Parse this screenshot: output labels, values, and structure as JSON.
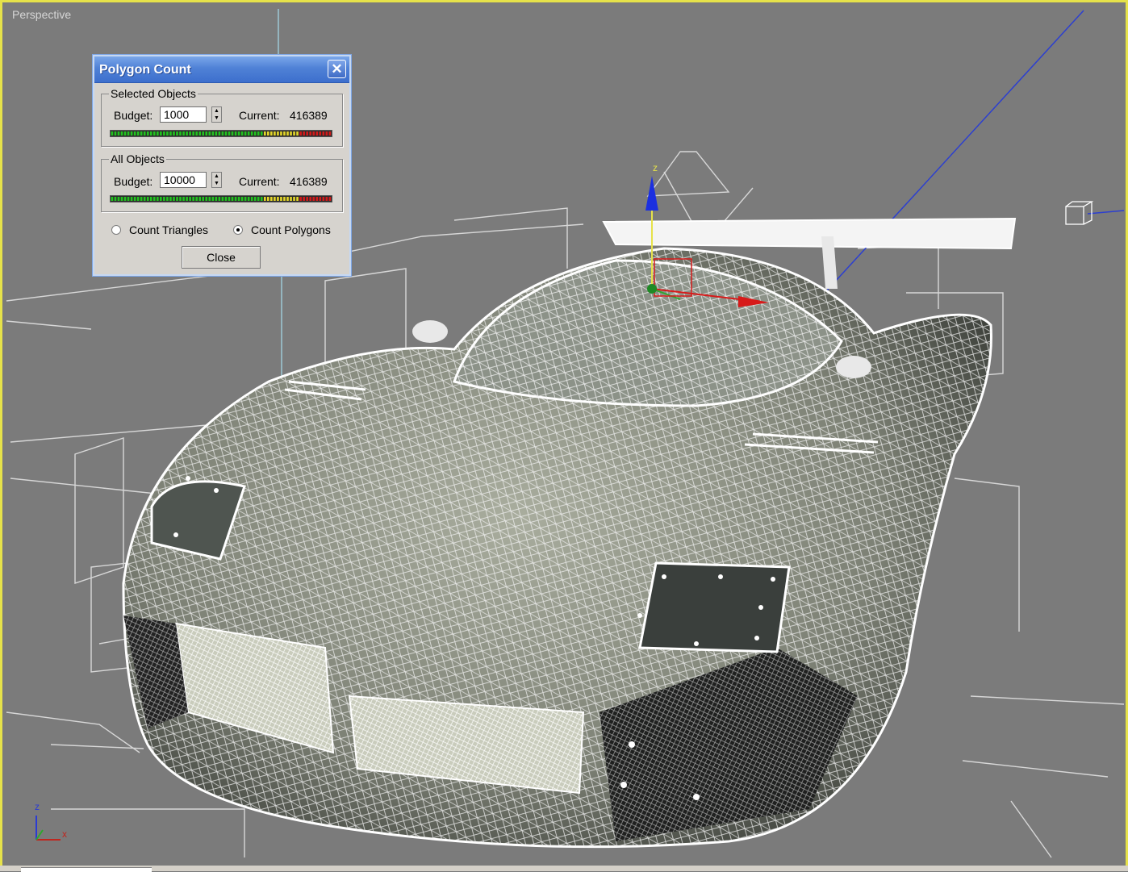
{
  "viewport": {
    "label": "Perspective"
  },
  "dialog": {
    "title": "Polygon Count",
    "selected": {
      "legend": "Selected Objects",
      "budget_label": "Budget:",
      "budget_value": "1000",
      "current_label": "Current:",
      "current_value": "416389"
    },
    "all": {
      "legend": "All Objects",
      "budget_label": "Budget:",
      "budget_value": "10000",
      "current_label": "Current:",
      "current_value": "416389"
    },
    "radio_triangles": "Count Triangles",
    "radio_polygons": "Count Polygons",
    "selected_mode": "polygons",
    "close_label": "Close"
  },
  "axis": {
    "z": "z",
    "x": "x"
  },
  "colors": {
    "viewport_border": "#e6e24a",
    "title_bar": "#4f81d6",
    "meter_green": "#22c21f",
    "meter_yellow": "#e3d62a",
    "meter_red": "#d11a1a"
  }
}
